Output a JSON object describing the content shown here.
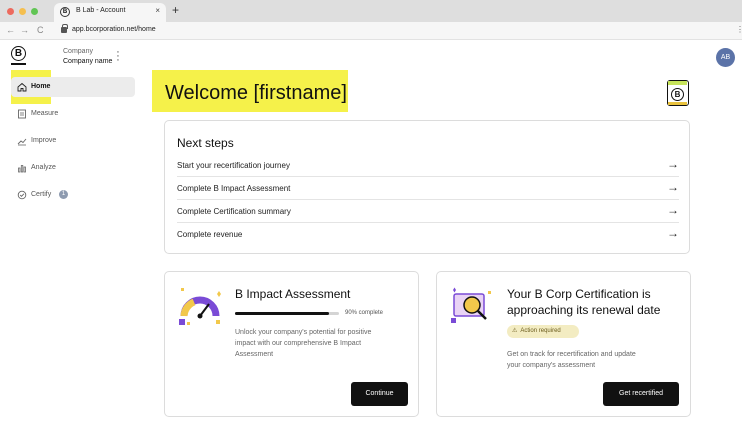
{
  "browser": {
    "tab_title": "B Lab - Account",
    "tab_close": "×",
    "new_tab": "+",
    "url": "app.bcorporation.net/home",
    "back": "←",
    "forward": "→",
    "reload": "C",
    "menu": "⋮",
    "traffic_colors": [
      "#ed6a5e",
      "#f5bf4f",
      "#61c554"
    ]
  },
  "sidebar": {
    "logo": "B",
    "company_label": "Company",
    "company_name": "Company name",
    "items": [
      {
        "label": "Home",
        "icon": "home-icon",
        "active": true
      },
      {
        "label": "Measure",
        "icon": "clipboard-icon",
        "active": false
      },
      {
        "label": "Improve",
        "icon": "trend-icon",
        "active": false
      },
      {
        "label": "Analyze",
        "icon": "bar-chart-icon",
        "active": false
      },
      {
        "label": "Certify",
        "icon": "check-circle-icon",
        "active": false,
        "badge": "1"
      }
    ]
  },
  "header": {
    "welcome": "Welcome [firstname]",
    "avatar_initials": "AB"
  },
  "next_steps": {
    "title": "Next steps",
    "arrow": "→",
    "items": [
      "Start your recertification journey",
      "Complete B Impact Assessment",
      "Complete Certification summary",
      "Complete revenue"
    ]
  },
  "impact_card": {
    "title": "B Impact Assessment",
    "progress_percent": 90,
    "progress_text": "90% complete",
    "description_lines": [
      "Unlock your company's potential for positive",
      "impact with our comprehensive B Impact",
      "Assessment"
    ],
    "button": "Continue"
  },
  "renew_card": {
    "title_lines": [
      "Your B Corp Certification is",
      "approaching its renewal date"
    ],
    "badge_icon": "⚠",
    "badge": "Action required",
    "description_lines": [
      "Get on track for recertification and update",
      "your company's assessment"
    ],
    "button": "Get recertified"
  },
  "colors": {
    "highlight": "#f5f14a",
    "avatar": "#5b73a8",
    "button": "#111111",
    "accent_purple": "#7a4bd6",
    "accent_yellow": "#f2c84b"
  }
}
